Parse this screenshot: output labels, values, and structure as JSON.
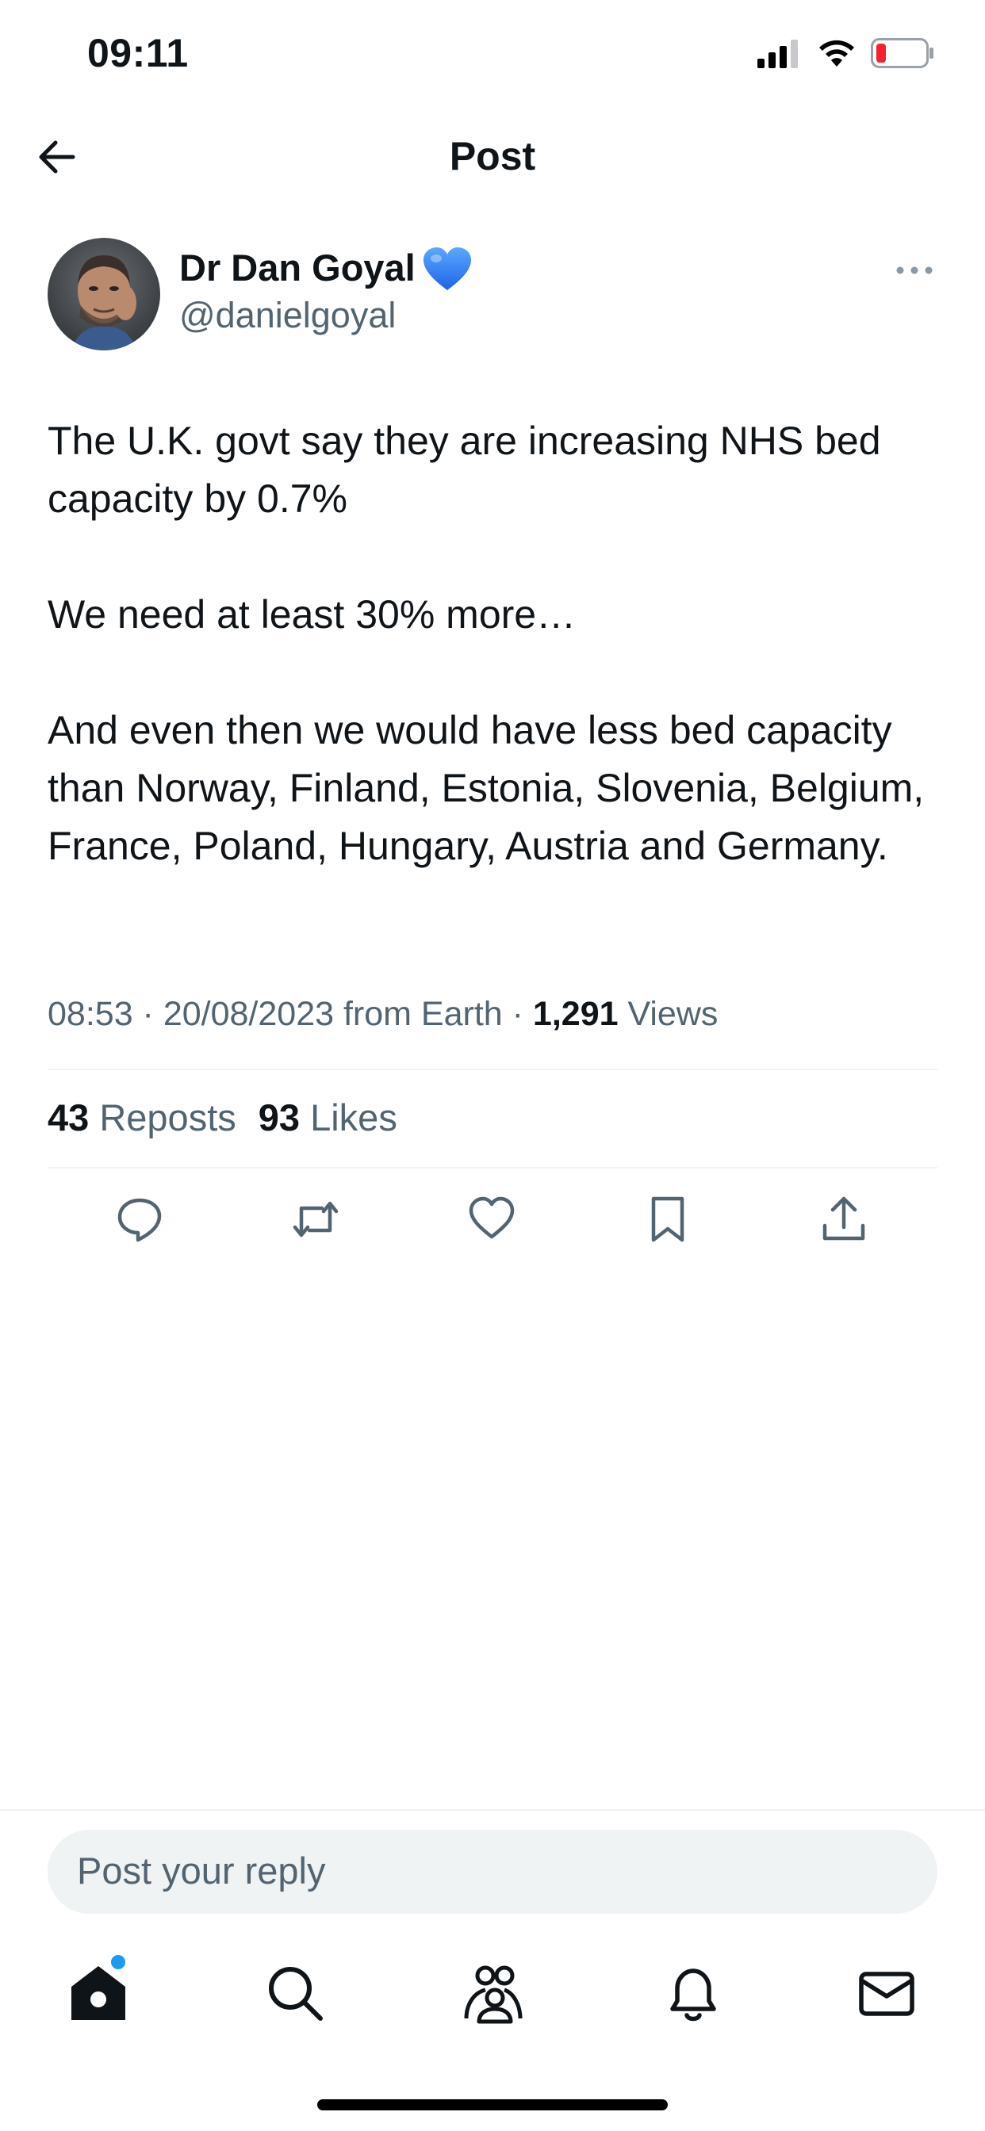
{
  "status_bar": {
    "time": "09:11",
    "icons": [
      "signal-icon",
      "wifi-icon",
      "battery-icon"
    ]
  },
  "header": {
    "title": "Post",
    "back_icon": "arrow-left-icon"
  },
  "post": {
    "author_name": "Dr Dan Goyal",
    "author_badge_icon": "blue-heart-icon",
    "author_handle": "@danielgoyal",
    "paragraphs": [
      "The U.K. govt say they are increasing NHS bed capacity by 0.7%",
      "We need at least 30% more…",
      "And even then we would have less bed capacity than Norway, Finland, Estonia, Slovenia, Belgium, France, Poland, Hungary, Austria and Germany."
    ],
    "meta_prefix": "08:53 · 20/08/2023 from Earth · ",
    "views_count": "1,291",
    "views_label": " Views",
    "reposts_count": "43",
    "reposts_label": " Reposts",
    "likes_count": "93",
    "likes_label": " Likes"
  },
  "actions": [
    "reply-icon",
    "repost-icon",
    "like-icon",
    "bookmark-icon",
    "share-icon"
  ],
  "reply": {
    "placeholder": "Post your reply"
  },
  "tab_bar": [
    "home-icon",
    "search-icon",
    "communities-icon",
    "notifications-icon",
    "messages-icon"
  ],
  "colors": {
    "text": "#0f1419",
    "secondary": "#536471",
    "divider": "#eff3f4",
    "accent": "#1d9bf0",
    "battery_low": "#f4212e"
  }
}
